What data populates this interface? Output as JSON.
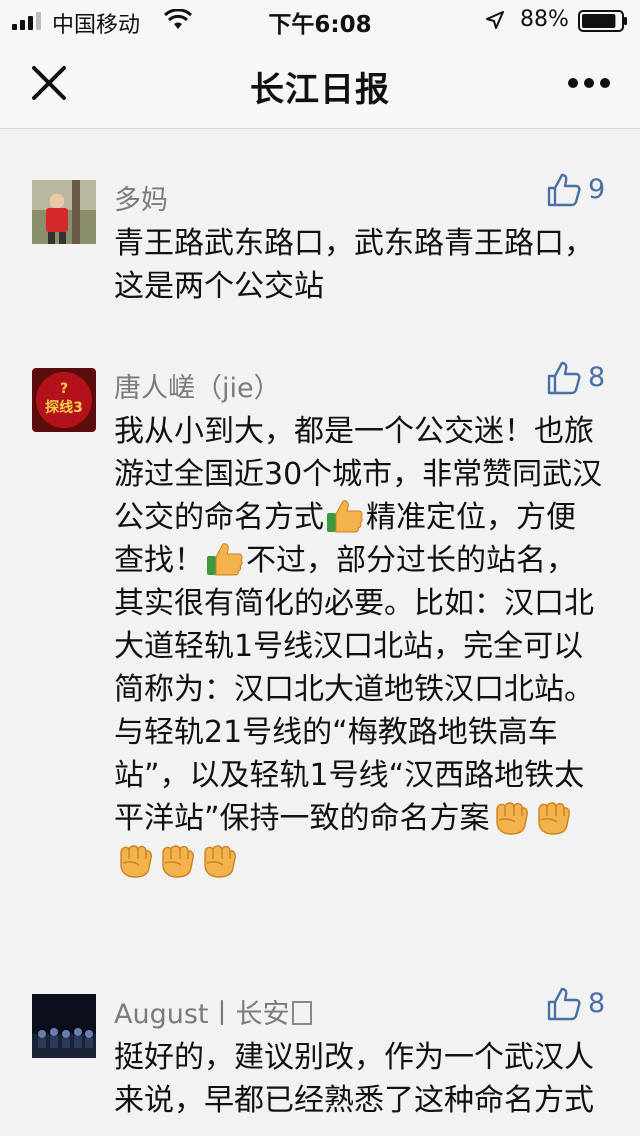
{
  "status": {
    "carrier": "中国移动",
    "time": "下午6:08",
    "battery_pct": "88%",
    "battery_level": 0.88
  },
  "nav": {
    "title": "长江日报"
  },
  "comments": [
    {
      "name": "多妈",
      "likes": "9",
      "text": "青王路武东路口，武东路青王路口，这是两个公交站"
    },
    {
      "name": "唐人嵯（jie）",
      "likes": "8",
      "avatar_text": "探线3",
      "text_parts": [
        "我从小到大，都是一个公交迷！也旅游过全国近30个城市，非常赞同武汉公交的命名方式",
        "精准定位，方便查找！",
        "不过，部分过长的站名，其实很有简化的必要。比如：汉口北大道轻轨1号线汉口北站，完全可以简称为：汉口北大道地铁汉口北站。与轻轨21号线的“梅教路地铁高车站”，以及轻轨1号线“汉西路地铁太平洋站”保持一致的命名方案"
      ]
    },
    {
      "name": "August丨长安",
      "likes": "8",
      "text": "挺好的，建议别改，作为一个武汉人来说，早都已经熟悉了这种命名方式"
    }
  ],
  "icons": {
    "like": "thumbs-up-outline-icon",
    "thumbs_emoji": "thumbs-up-emoji",
    "fist_emoji": "raised-fist-emoji"
  },
  "colors": {
    "like_blue": "#4a6fa5",
    "name_gray": "#7b7b7b",
    "background": "#f2f2f2"
  }
}
